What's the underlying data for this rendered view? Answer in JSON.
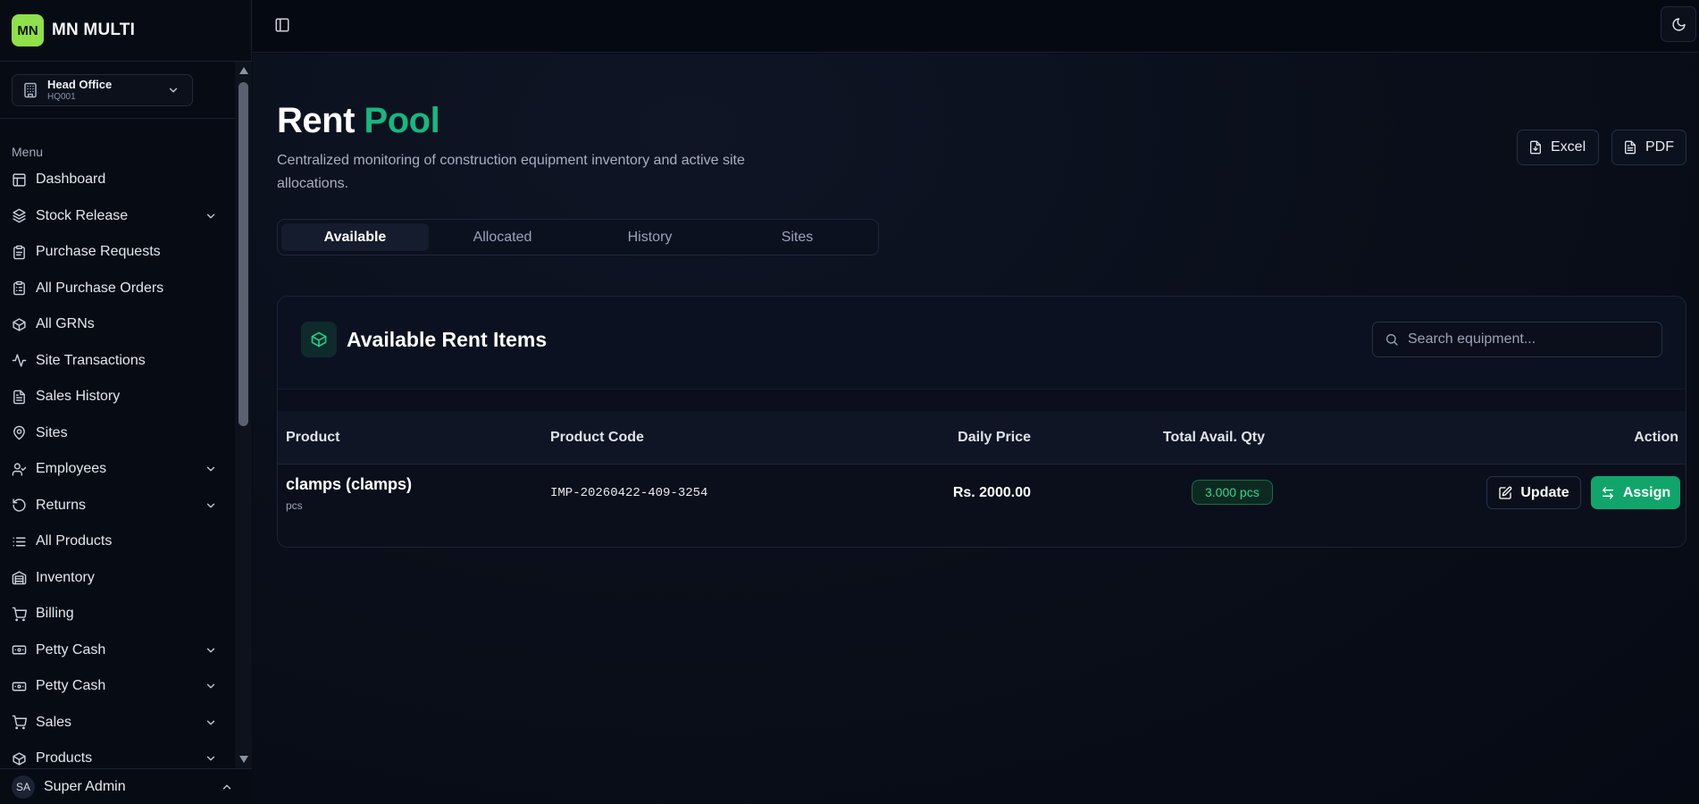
{
  "brand": {
    "logo_text": "MN",
    "name": "MN MULTI"
  },
  "office": {
    "name": "Head Office",
    "code": "HQ001"
  },
  "sidebar": {
    "menu_label": "Menu",
    "items": [
      {
        "label": "Dashboard",
        "icon": "grid-icon",
        "has_submenu": false
      },
      {
        "label": "Stock Release",
        "icon": "boxes-icon",
        "has_submenu": true
      },
      {
        "label": "Purchase Requests",
        "icon": "clipboard-icon",
        "has_submenu": false
      },
      {
        "label": "All Purchase Orders",
        "icon": "clipboard-list-icon",
        "has_submenu": false
      },
      {
        "label": "All GRNs",
        "icon": "package-icon",
        "has_submenu": false
      },
      {
        "label": "Site Transactions",
        "icon": "activity-icon",
        "has_submenu": false
      },
      {
        "label": "Sales History",
        "icon": "file-text-icon",
        "has_submenu": false
      },
      {
        "label": "Sites",
        "icon": "map-pin-icon",
        "has_submenu": false
      },
      {
        "label": "Employees",
        "icon": "user-check-icon",
        "has_submenu": true
      },
      {
        "label": "Returns",
        "icon": "rotate-ccw-icon",
        "has_submenu": true
      },
      {
        "label": "All Products",
        "icon": "list-icon",
        "has_submenu": false
      },
      {
        "label": "Inventory",
        "icon": "warehouse-icon",
        "has_submenu": false
      },
      {
        "label": "Billing",
        "icon": "shopping-cart-icon",
        "has_submenu": false
      },
      {
        "label": "Petty Cash",
        "icon": "banknote-icon",
        "has_submenu": true
      },
      {
        "label": "Petty Cash",
        "icon": "banknote-icon",
        "has_submenu": true
      },
      {
        "label": "Sales",
        "icon": "shopping-cart-icon",
        "has_submenu": true
      },
      {
        "label": "Products",
        "icon": "package-icon",
        "has_submenu": true
      }
    ]
  },
  "user": {
    "initials": "SA",
    "name": "Super Admin"
  },
  "page": {
    "title_main": "Rent",
    "title_accent": "Pool",
    "subtitle": "Centralized monitoring of construction equipment inventory and active site allocations.",
    "export_excel": "Excel",
    "export_pdf": "PDF"
  },
  "tabs": [
    {
      "label": "Available",
      "active": true
    },
    {
      "label": "Allocated",
      "active": false
    },
    {
      "label": "History",
      "active": false
    },
    {
      "label": "Sites",
      "active": false
    }
  ],
  "card": {
    "title": "Available Rent Items",
    "search_placeholder": "Search equipment...",
    "columns": {
      "product": "Product",
      "code": "Product Code",
      "price": "Daily Price",
      "qty": "Total Avail. Qty",
      "action": "Action"
    },
    "rows": [
      {
        "name": "clamps (clamps)",
        "unit": "pcs",
        "code": "IMP-20260422-409-3254",
        "price": "Rs. 2000.00",
        "qty": "3.000 pcs",
        "update_label": "Update",
        "assign_label": "Assign"
      }
    ]
  },
  "colors": {
    "accent": "#18b77d",
    "brand_logo": "#8fe04a",
    "background": "#070b14"
  }
}
